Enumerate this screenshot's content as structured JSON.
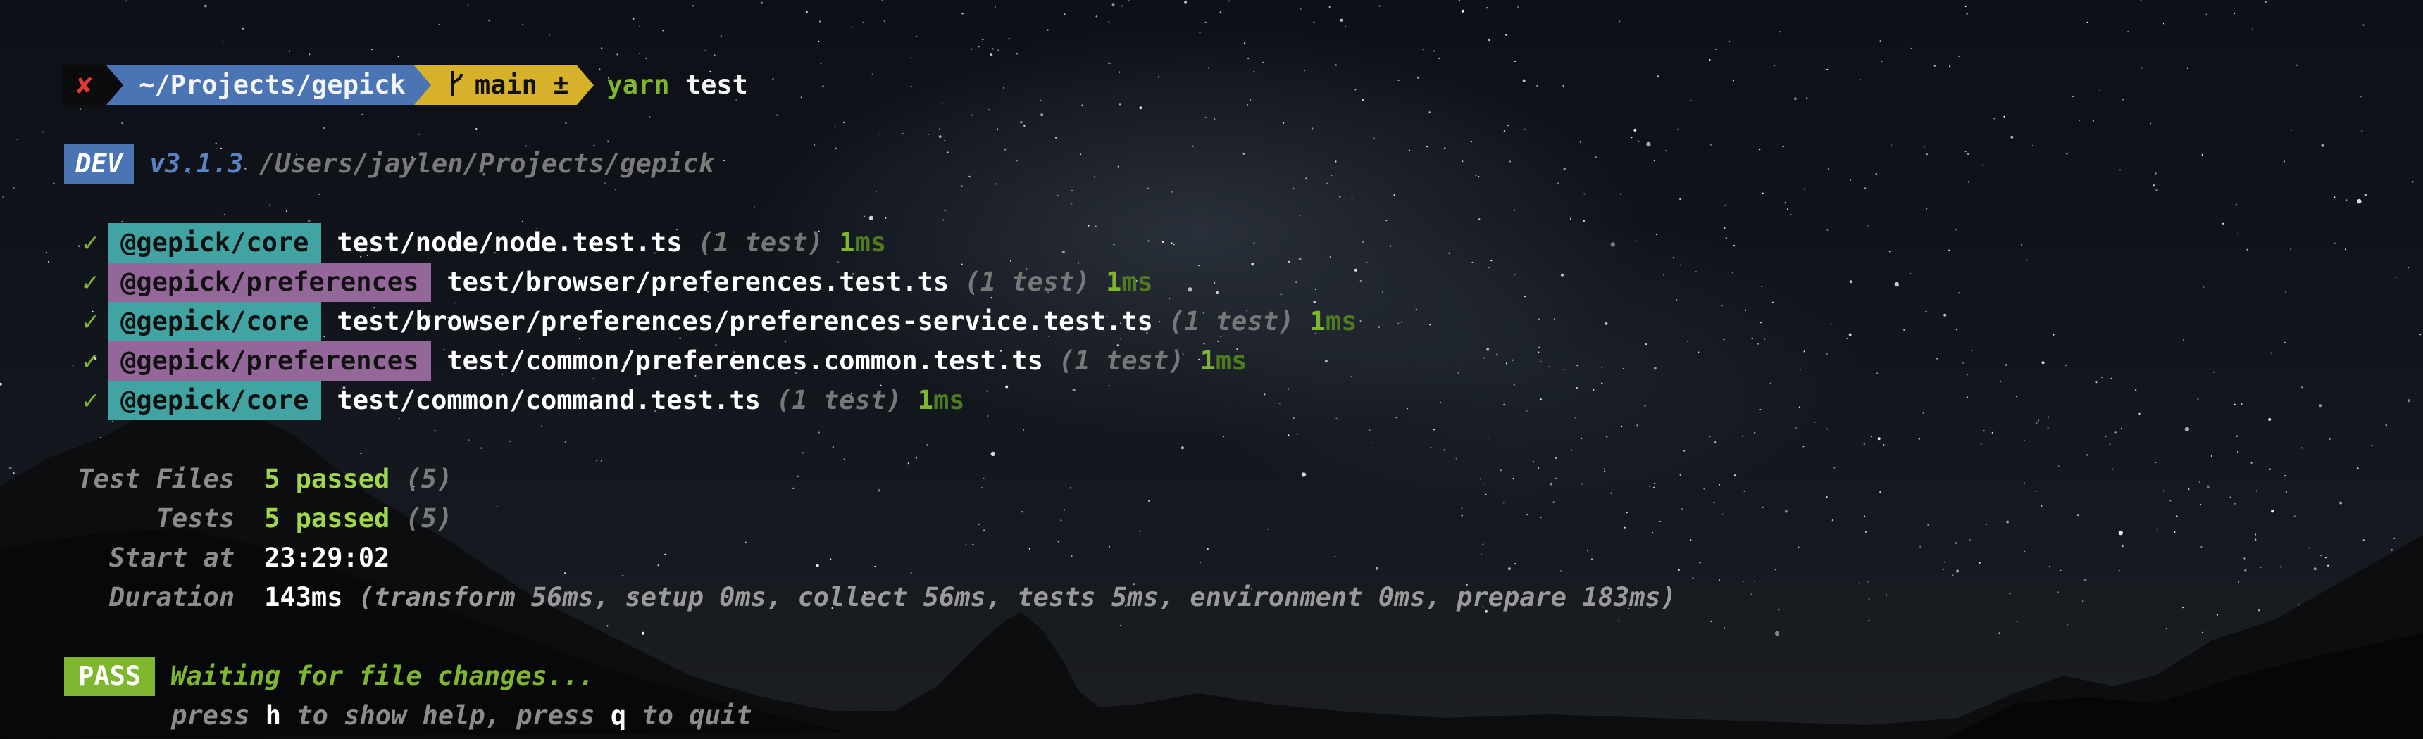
{
  "prompt": {
    "status_icon": "✘",
    "path": "~/Projects/gepick",
    "git_icon": "branch-icon",
    "branch": "main ±",
    "command": "yarn",
    "argument": "test"
  },
  "run_header": {
    "mode_badge": "DEV",
    "version": "v3.1.3",
    "cwd": "/Users/jaylen/Projects/gepick"
  },
  "test_results": [
    {
      "status": "✓",
      "package": "@gepick/core",
      "package_color": "#42a3a3",
      "file": "test/node/node.test.ts",
      "count": "(1 test)",
      "duration": "1",
      "unit": "ms"
    },
    {
      "status": "✓",
      "package": "@gepick/preferences",
      "package_color": "#93679a",
      "file": "test/browser/preferences.test.ts",
      "count": "(1 test)",
      "duration": "1",
      "unit": "ms"
    },
    {
      "status": "✓",
      "package": "@gepick/core",
      "package_color": "#42a3a3",
      "file": "test/browser/preferences/preferences-service.test.ts",
      "count": "(1 test)",
      "duration": "1",
      "unit": "ms"
    },
    {
      "status": "✓",
      "package": "@gepick/preferences",
      "package_color": "#93679a",
      "file": "test/common/preferences.common.test.ts",
      "count": "(1 test)",
      "duration": "1",
      "unit": "ms"
    },
    {
      "status": "✓",
      "package": "@gepick/core",
      "package_color": "#42a3a3",
      "file": "test/common/command.test.ts",
      "count": "(1 test)",
      "duration": "1",
      "unit": "ms"
    }
  ],
  "summary": {
    "test_files_label": "Test Files",
    "test_files_value": "5 passed",
    "test_files_total": "(5)",
    "tests_label": "Tests",
    "tests_value": "5 passed",
    "tests_total": "(5)",
    "start_label": "Start at",
    "start_value": "23:29:02",
    "duration_label": "Duration",
    "duration_value": "143ms",
    "duration_breakdown": "(transform 56ms, setup 0ms, collect 56ms, tests 5ms, environment 0ms, prepare 183ms)"
  },
  "watch": {
    "badge": "PASS",
    "message": "Waiting for file changes...",
    "hint_press_1": "press",
    "hint_key_help": "h",
    "hint_help_text": "to show help, press",
    "hint_key_quit": "q",
    "hint_quit_text": "to quit"
  },
  "colors": {
    "prompt_path_bg": "#4a74b3",
    "prompt_git_bg": "#d8b12a",
    "pass_green": "#7fb62f",
    "error_red": "#e23a2e",
    "core_badge": "#42a3a3",
    "preferences_badge": "#93679a"
  }
}
